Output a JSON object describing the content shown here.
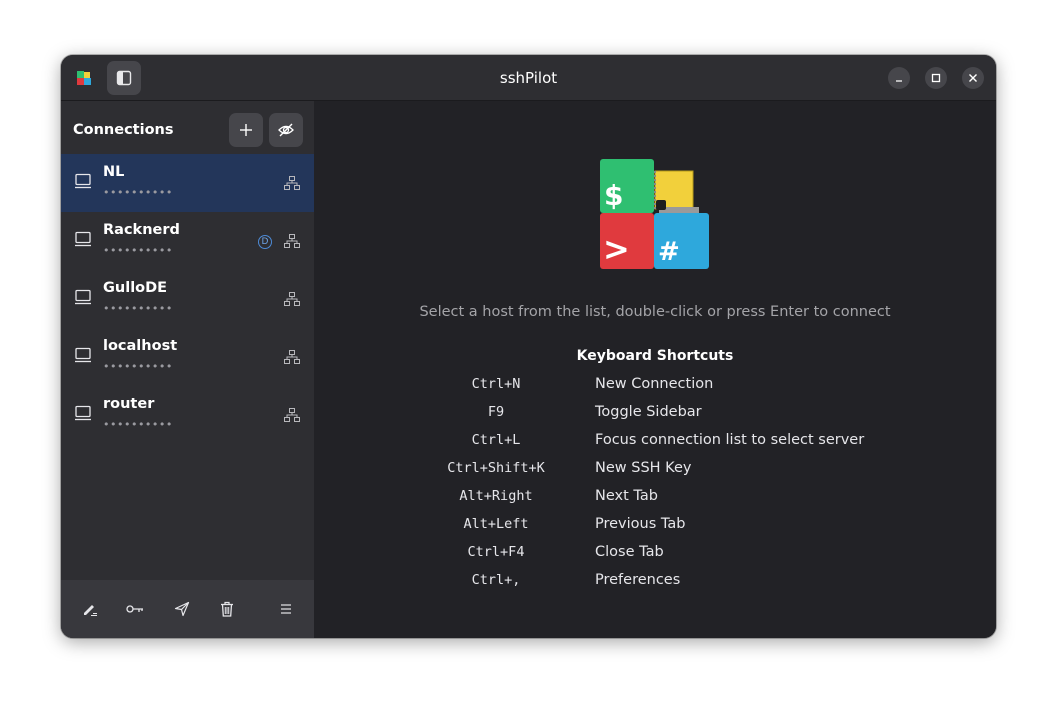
{
  "window": {
    "title": "sshPilot"
  },
  "sidebar": {
    "title": "Connections",
    "connections": [
      {
        "name": "NL",
        "host": "••••••••••",
        "selected": true,
        "badge": null
      },
      {
        "name": "Racknerd",
        "host": "••••••••••",
        "selected": false,
        "badge": "D"
      },
      {
        "name": "GulloDE",
        "host": "••••••••••",
        "selected": false,
        "badge": null
      },
      {
        "name": "localhost",
        "host": "••••••••••",
        "selected": false,
        "badge": null
      },
      {
        "name": "router",
        "host": "••••••••••",
        "selected": false,
        "badge": null
      }
    ]
  },
  "welcome": {
    "hint": "Select a host from the list, double-click or press Enter to connect",
    "shortcuts_title": "Keyboard Shortcuts",
    "shortcuts": [
      {
        "key": "Ctrl+N",
        "desc": "New Connection"
      },
      {
        "key": "F9",
        "desc": "Toggle Sidebar"
      },
      {
        "key": "Ctrl+L",
        "desc": "Focus connection list to select server"
      },
      {
        "key": "Ctrl+Shift+K",
        "desc": "New SSH Key"
      },
      {
        "key": "Alt+Right",
        "desc": "Next Tab"
      },
      {
        "key": "Alt+Left",
        "desc": "Previous Tab"
      },
      {
        "key": "Ctrl+F4",
        "desc": "Close Tab"
      },
      {
        "key": "Ctrl+,",
        "desc": "Preferences"
      }
    ]
  },
  "colors": {
    "accent_selected": "#23365a",
    "logo_green": "#2fbf71",
    "logo_yellow": "#f2d03b",
    "logo_red": "#e03a3e",
    "logo_blue": "#2ea8dc"
  },
  "icons": {
    "titlebar": [
      "app-icon",
      "sidebar-toggle-icon",
      "minimize-icon",
      "maximize-icon",
      "close-icon"
    ],
    "sidebar_header": [
      "plus-icon",
      "eye-off-icon"
    ],
    "connection": [
      "computer-icon",
      "network-icon",
      "badge-d-icon"
    ],
    "footer": [
      "edit-icon",
      "key-icon",
      "send-icon",
      "trash-icon",
      "menu-icon"
    ]
  }
}
